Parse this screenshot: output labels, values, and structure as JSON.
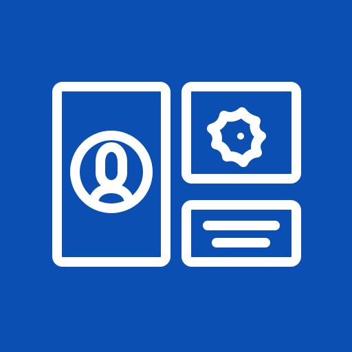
{
  "colors": {
    "background": "#0b4fb3",
    "foreground": "#ffffff"
  },
  "icons": {
    "profile": "user-profile-icon",
    "settings": "gear-icon",
    "text": "text-lines-icon"
  }
}
